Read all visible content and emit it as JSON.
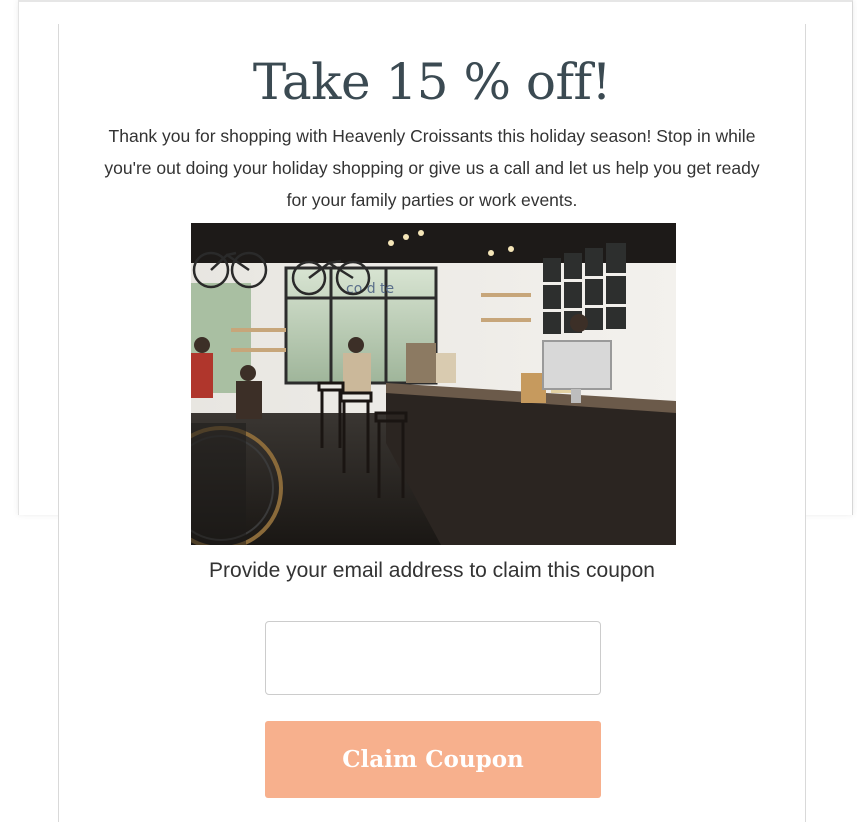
{
  "popup": {
    "headline": "Take 15 % off!",
    "body_line1": "Thank you for shopping with Heavenly Croissants this holiday season! Stop in while",
    "body_line2": "you're out doing your holiday shopping or give us a call and let us help you get ready",
    "body_line3": "for your family parties or work events.",
    "image": {
      "subject": "cafe-interior-photo",
      "sign_text": "co  d  te"
    },
    "email_prompt": "Provide your email address to claim this coupon",
    "email_input": {
      "value": "",
      "placeholder": ""
    },
    "claim_button_label": "Claim Coupon"
  },
  "colors": {
    "headline": "#3b4a52",
    "body_text": "#333333",
    "button_bg": "#f7b08d",
    "button_text": "#ffffff",
    "input_border": "#cccccc"
  }
}
